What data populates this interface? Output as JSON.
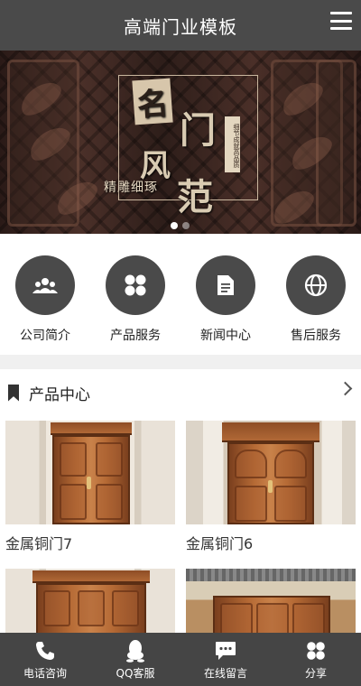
{
  "header": {
    "title": "高端门业模板",
    "menu_icon": "hamburger-menu-icon"
  },
  "banner": {
    "chars": [
      "名",
      "门",
      "风",
      "范"
    ],
    "slogan": "精雕细琢",
    "stamp": "细节成就高品质",
    "slide_count": 2,
    "active_slide": 1
  },
  "nav": [
    {
      "label": "公司简介",
      "icon": "people-icon"
    },
    {
      "label": "产品服务",
      "icon": "grid-icon"
    },
    {
      "label": "新闻中心",
      "icon": "document-icon"
    },
    {
      "label": "售后服务",
      "icon": "globe-icon"
    }
  ],
  "products_section": {
    "title": "产品中心",
    "items": [
      {
        "name": "金属铜门7"
      },
      {
        "name": "金属铜门6"
      },
      {
        "name": ""
      },
      {
        "name": ""
      }
    ]
  },
  "toolbar": [
    {
      "label": "电话咨询",
      "icon": "phone-icon"
    },
    {
      "label": "QQ客服",
      "icon": "qq-icon"
    },
    {
      "label": "在线留言",
      "icon": "message-icon"
    },
    {
      "label": "分享",
      "icon": "share-icon"
    }
  ],
  "colors": {
    "header_bg": "#4a4a4a",
    "icon_circle": "#4a4a4a",
    "toolbar_bg": "#454545"
  }
}
